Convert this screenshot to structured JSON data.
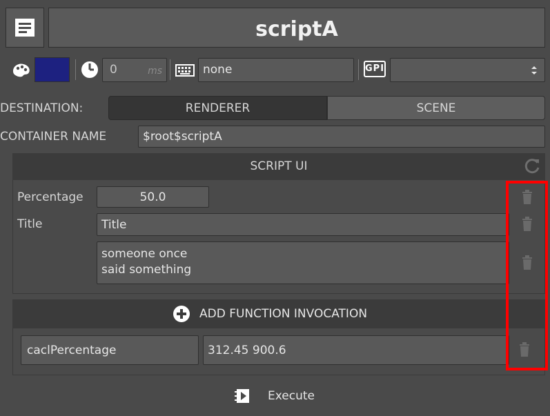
{
  "header": {
    "title": "scriptA",
    "doc_icon": "document-icon"
  },
  "toolbar": {
    "color_icon": "palette-icon",
    "color_value": "#1d2180",
    "clock_icon": "clock-icon",
    "delay_value": "0",
    "delay_unit": "ms",
    "keyboard_icon": "keyboard-icon",
    "hotkey_value": "none",
    "gpi_label": "GPI",
    "gpi_select_value": ""
  },
  "destination": {
    "label": "DESTINATION:",
    "options": [
      "RENDERER",
      "SCENE"
    ]
  },
  "container": {
    "label": "CONTAINER NAME",
    "value": "$root$scriptA"
  },
  "script_ui": {
    "title": "SCRIPT UI",
    "refresh_icon": "refresh-icon",
    "fields": [
      {
        "label": "Percentage",
        "value": "50.0"
      },
      {
        "label": "Title",
        "value": "Title"
      },
      {
        "label": "",
        "value_lines": [
          "someone once",
          "said something"
        ]
      }
    ]
  },
  "functions": {
    "add_label": "ADD FUNCTION INVOCATION",
    "add_icon": "plus-circle-icon",
    "items": [
      {
        "name": "caclPercentage",
        "args": "312.45 900.6"
      }
    ]
  },
  "execute": {
    "label": "Execute",
    "icon": "execute-icon"
  },
  "highlight_color": "#ff0000"
}
